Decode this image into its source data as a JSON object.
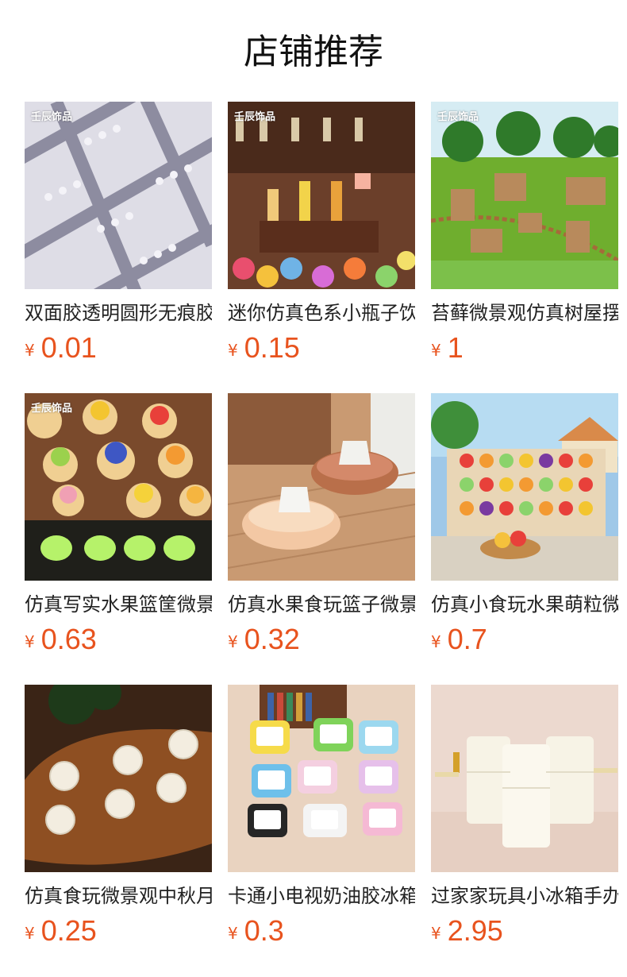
{
  "page": {
    "title": "店铺推荐"
  },
  "products": [
    {
      "name": "双面胶透明圆形无痕胶",
      "currency": "¥",
      "price": "0.01",
      "brand": "壬辰饰品"
    },
    {
      "name": "迷你仿真色系小瓶子饮料",
      "currency": "¥",
      "price": "0.15",
      "brand": "壬辰饰品"
    },
    {
      "name": "苔藓微景观仿真树屋摆件",
      "currency": "¥",
      "price": "1",
      "brand": "壬辰饰品"
    },
    {
      "name": "仿真写实水果篮筐微景观",
      "currency": "¥",
      "price": "0.63",
      "brand": "壬辰饰品"
    },
    {
      "name": "仿真水果食玩篮子微景观",
      "currency": "¥",
      "price": "0.32",
      "brand": ""
    },
    {
      "name": "仿真小食玩水果萌粒微景",
      "currency": "¥",
      "price": "0.7",
      "brand": ""
    },
    {
      "name": "仿真食玩微景观中秋月饼",
      "currency": "¥",
      "price": "0.25",
      "brand": ""
    },
    {
      "name": "卡通小电视奶油胶冰箱贴",
      "currency": "¥",
      "price": "0.3",
      "brand": ""
    },
    {
      "name": "过家家玩具小冰箱手办",
      "currency": "¥",
      "price": "2.95",
      "brand": ""
    }
  ],
  "colors": {
    "price": "#e8531e",
    "title": "#111111",
    "name": "#222222"
  }
}
